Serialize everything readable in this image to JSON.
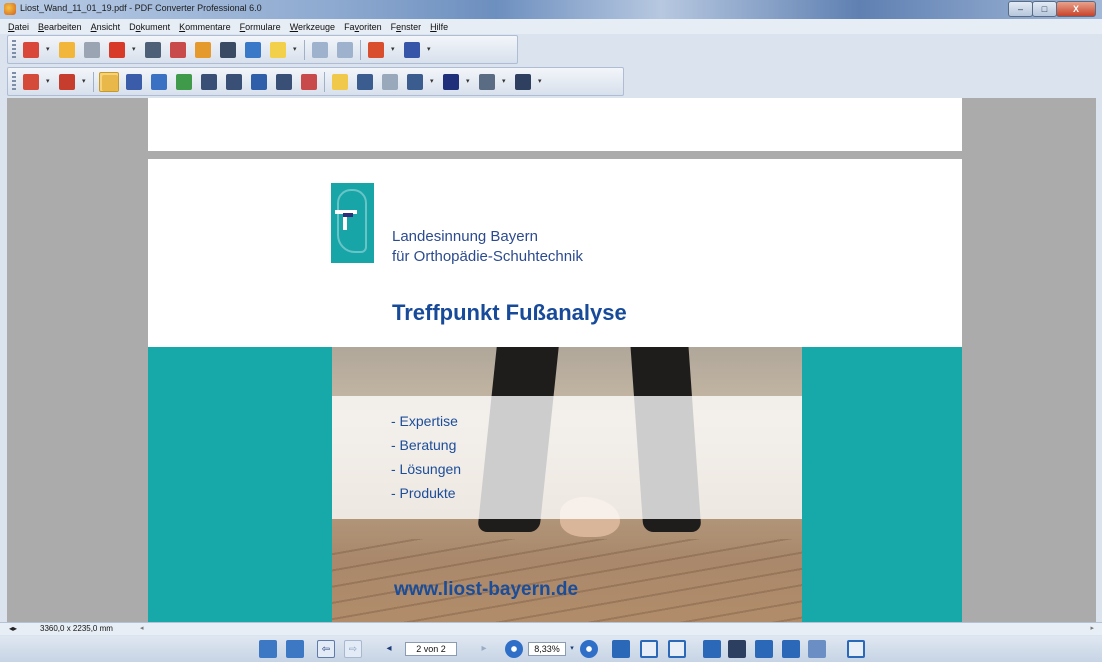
{
  "window": {
    "title": "Liost_Wand_11_01_19.pdf - PDF Converter Professional 6.0",
    "minimize_label": "–",
    "maximize_label": "□",
    "close_label": "X"
  },
  "menu": [
    {
      "hot": "D",
      "rest": "atei"
    },
    {
      "hot": "B",
      "rest": "earbeiten"
    },
    {
      "hot": "A",
      "rest": "nsicht"
    },
    {
      "pre": "D",
      "hot": "o",
      "rest": "kument"
    },
    {
      "hot": "K",
      "rest": "ommentare"
    },
    {
      "hot": "F",
      "rest": "ormulare"
    },
    {
      "hot": "W",
      "rest": "erkzeuge"
    },
    {
      "pre": "Fa",
      "hot": "v",
      "rest": "oriten"
    },
    {
      "pre": "F",
      "hot": "e",
      "rest": "nster"
    },
    {
      "hot": "H",
      "rest": "ilfe"
    }
  ],
  "toolbar1_icons": [
    {
      "name": "create-pdf-icon",
      "color": "#d9473b"
    },
    {
      "name": "open-folder-icon",
      "color": "#f1b63a"
    },
    {
      "name": "save-icon",
      "color": "#9aa4b2"
    },
    {
      "name": "convert-icon",
      "color": "#d83a2a"
    },
    {
      "name": "print-icon",
      "color": "#4e5f78"
    },
    {
      "name": "email-pdf-icon",
      "color": "#c94a4a"
    },
    {
      "name": "package-icon",
      "color": "#e59a2d"
    },
    {
      "name": "find-icon",
      "color": "#3b4a63"
    },
    {
      "name": "binder-icon",
      "color": "#3a78c8"
    },
    {
      "name": "star-icon",
      "color": "#f2d04a"
    },
    {
      "name": "undo-icon",
      "color": "#9fb2cd"
    },
    {
      "name": "redo-icon",
      "color": "#9fb2cd"
    },
    {
      "name": "security-icon",
      "color": "#d94e2d"
    },
    {
      "name": "pen-icon",
      "color": "#3654a8"
    }
  ],
  "toolbar2_icons": [
    {
      "name": "stamp-icon",
      "color": "#d54b3a"
    },
    {
      "name": "color-icon",
      "color": "#c63d2e"
    },
    {
      "name": "hand-tool-icon",
      "color": "#e8b94a",
      "pressed": true
    },
    {
      "name": "text-select-icon",
      "color": "#3b5ca8"
    },
    {
      "name": "set-icon",
      "color": "#3a71c2"
    },
    {
      "name": "image-select-icon",
      "color": "#3f9a4a"
    },
    {
      "name": "pointer-icon",
      "color": "#3a4f76"
    },
    {
      "name": "snapshot-icon",
      "color": "#3a4f76"
    },
    {
      "name": "crop-icon",
      "color": "#2f5fa8"
    },
    {
      "name": "text-box-icon",
      "color": "#3a4f76"
    },
    {
      "name": "picture-icon",
      "color": "#c94a4a"
    },
    {
      "name": "highlight-icon",
      "color": "#f1c94a"
    },
    {
      "name": "note-icon",
      "color": "#3a5c8f"
    },
    {
      "name": "comment-icon",
      "color": "#9aa8bc"
    },
    {
      "name": "typewriter-icon",
      "color": "#3a5c8f"
    },
    {
      "name": "header-icon",
      "color": "#1f2f7a"
    },
    {
      "name": "column-icon",
      "color": "#5a6b84"
    },
    {
      "name": "line-icon",
      "color": "#2f3f60"
    }
  ],
  "document": {
    "org_line1": "Landesinnung Bayern",
    "org_line2": "für Orthopädie-Schuhtechnik",
    "headline": "Treffpunkt Fußanalyse",
    "bullets": [
      "- Expertise",
      "- Beratung",
      "- Lösungen",
      "- Produkte"
    ],
    "url": "www.liost-bayern.de"
  },
  "status": {
    "dimensions": "3360,0 x 2235,0 mm"
  },
  "navigation": {
    "page_field": "2 von 2",
    "zoom_field": "8,33%"
  }
}
